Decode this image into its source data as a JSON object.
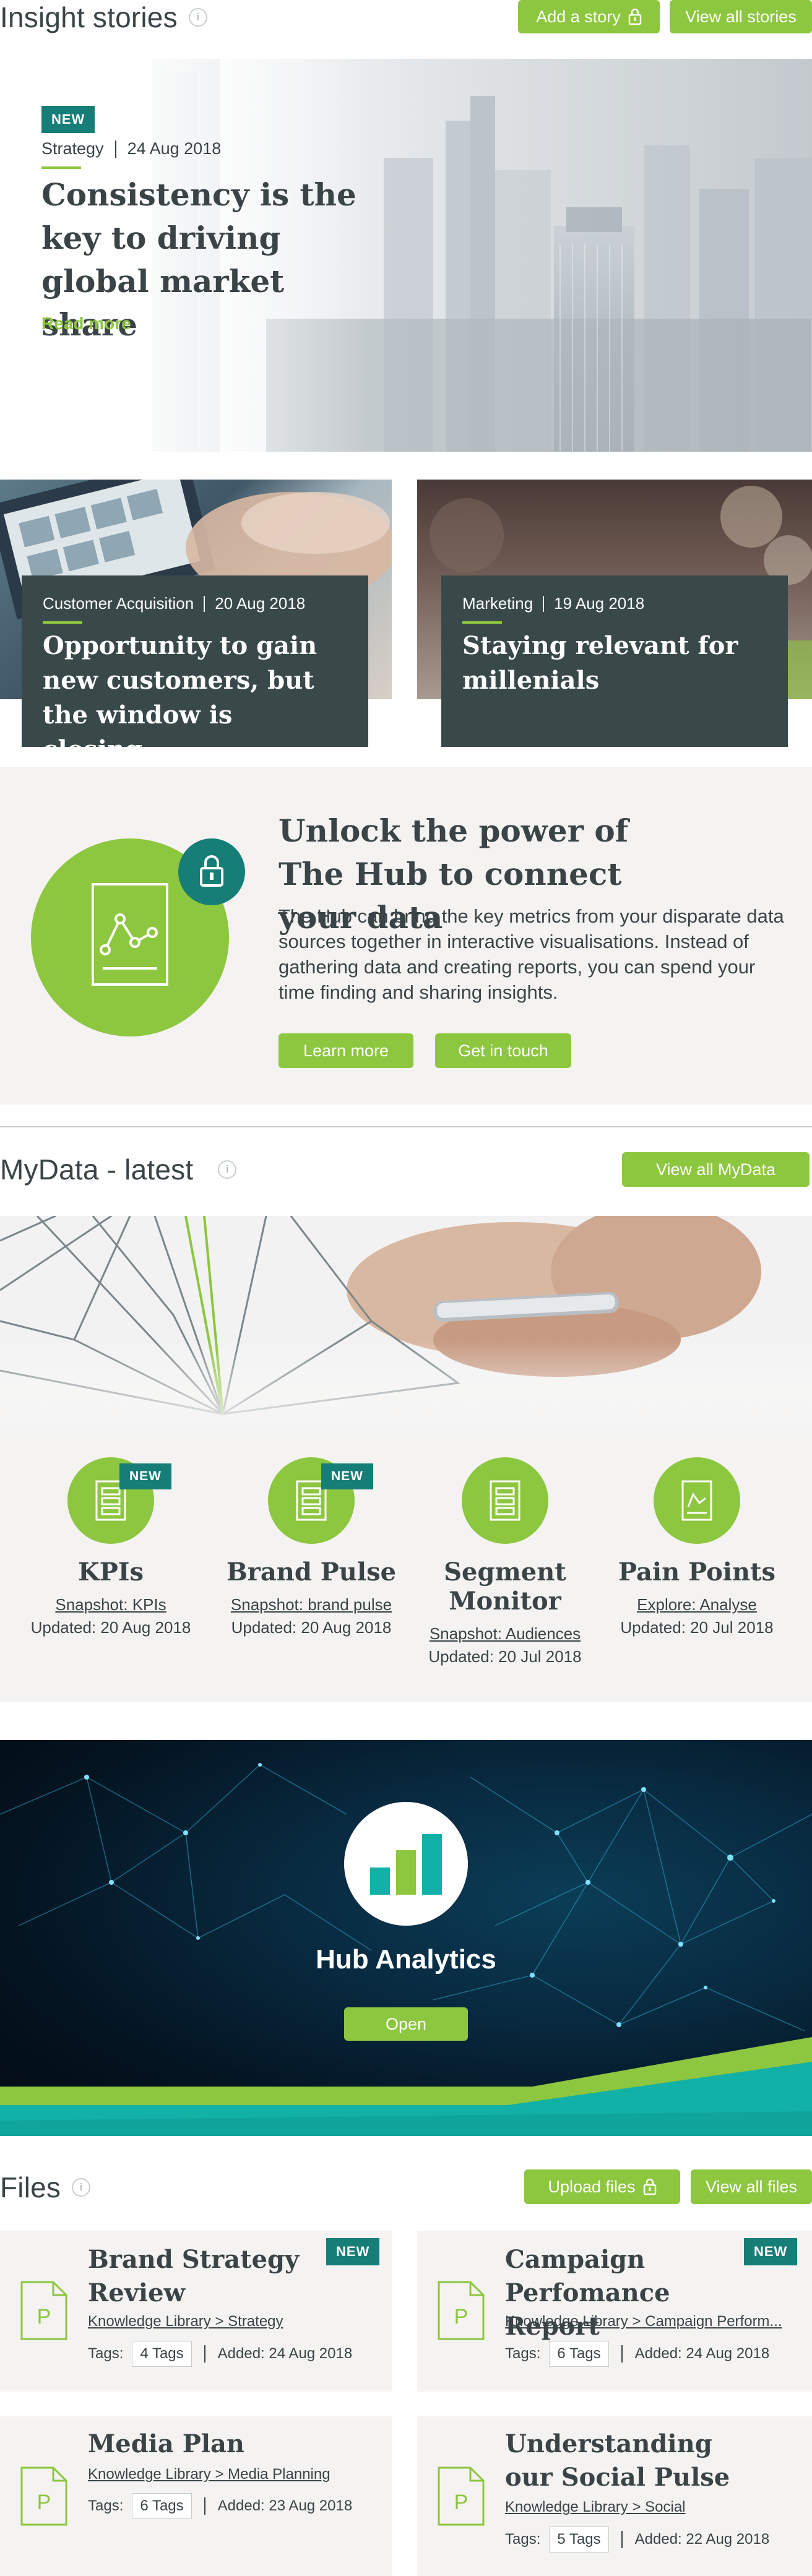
{
  "insight": {
    "title": "Insight stories",
    "add_story_label": "Add a story",
    "view_all_label": "View all stories",
    "hero": {
      "badge": "NEW",
      "category": "Strategy",
      "date": "24 Aug 2018",
      "headline": "Consistency is the key to driving global market share",
      "read_more": "Read more"
    },
    "cards": [
      {
        "category": "Customer Acquisition",
        "date": "20 Aug 2018",
        "headline": "Opportunity to gain new customers, but the window is closing"
      },
      {
        "category": "Marketing",
        "date": "19 Aug 2018",
        "headline": "Staying relevant for millenials"
      }
    ]
  },
  "promo": {
    "heading": "Unlock the power of The Hub to connect your data",
    "body": "The Hub can bring the key metrics from your disparate data sources together in interactive visualisations. Instead of gathering data and creating reports, you can spend your time finding and sharing insights.",
    "learn_more_label": "Learn more",
    "get_in_touch_label": "Get in touch"
  },
  "mydata": {
    "title": "MyData - latest",
    "view_all_label": "View all MyData",
    "items": [
      {
        "badge": "NEW",
        "name": "KPIs",
        "link": "Snapshot: KPIs",
        "updated": "Updated: 20 Aug 2018",
        "icon": "document-icon"
      },
      {
        "badge": "NEW",
        "name": "Brand Pulse",
        "link": "Snapshot: brand pulse",
        "updated": "Updated: 20 Aug 2018",
        "icon": "document-icon"
      },
      {
        "badge": "",
        "name": "Segment Monitor",
        "link": "Snapshot: Audiences",
        "updated": "Updated: 20 Jul 2018",
        "icon": "document-icon"
      },
      {
        "badge": "",
        "name": "Pain Points",
        "link": "Explore: Analyse",
        "updated": "Updated: 20 Jul 2018",
        "icon": "chart-doc-icon"
      }
    ]
  },
  "analytics": {
    "title": "Hub Analytics",
    "open_label": "Open"
  },
  "files": {
    "title": "Files",
    "upload_label": "Upload files",
    "view_all_label": "View all files",
    "tags_label": "Tags:",
    "items": [
      {
        "badge": "NEW",
        "title": "Brand Strategy Review",
        "path": "Knowledge Library > Strategy",
        "tags": "4 Tags",
        "added": "Added: 24 Aug 2018",
        "icon_letter": "P"
      },
      {
        "badge": "NEW",
        "title": "Campaign Perfomance Report",
        "path": "Knowledge Library > Campaign Perform...",
        "tags": "6 Tags",
        "added": "Added: 24 Aug 2018",
        "icon_letter": "P"
      },
      {
        "badge": "",
        "title": "Media Plan",
        "path": "Knowledge Library > Media Planning",
        "tags": "6 Tags",
        "added": "Added: 23 Aug 2018",
        "icon_letter": "P"
      },
      {
        "badge": "",
        "title": "Understanding our Social Pulse",
        "path": "Knowledge Library > Social",
        "tags": "5 Tags",
        "added": "Added: 22 Aug 2018",
        "icon_letter": "P"
      }
    ]
  },
  "colors": {
    "accent": "#8dc63f",
    "teal": "#167d77",
    "dark_card": "#39494a",
    "panel": "#f4f3f2"
  }
}
